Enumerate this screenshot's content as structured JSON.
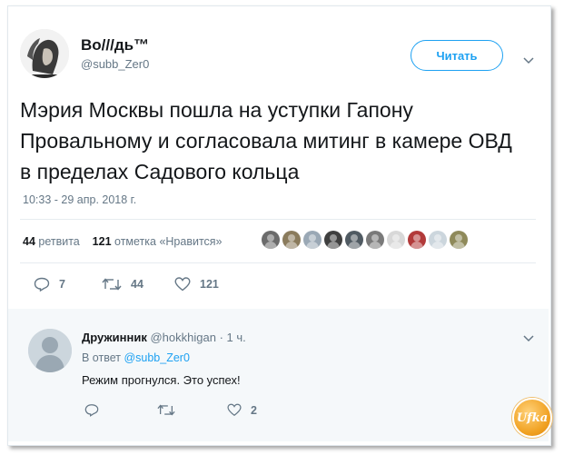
{
  "tweet": {
    "author_name": "Во///дь™",
    "author_handle": "@subb_Zer0",
    "follow_label": "Читать",
    "text": "Мэрия Москвы пошла на уступки Гапону Провальному и согласовала митинг в камере ОВД в пределах Садового кольца",
    "timestamp": "10:33 - 29 апр. 2018 г.",
    "retweets_count": "44",
    "retweets_label": "ретвита",
    "likes_count": "121",
    "likes_label": "отметка «Нравится»",
    "actions": {
      "reply_count": "7",
      "retweet_count": "44",
      "like_count": "121"
    },
    "likers": [
      {
        "icon": "liker-avatar",
        "color": "#6b6b6b"
      },
      {
        "icon": "liker-avatar",
        "color": "#8a7b5c"
      },
      {
        "icon": "liker-avatar",
        "color": "#9aa8b5"
      },
      {
        "icon": "liker-avatar",
        "color": "#3f3f3f"
      },
      {
        "icon": "liker-avatar",
        "color": "#505a62"
      },
      {
        "icon": "liker-avatar",
        "color": "#7a7a7a"
      },
      {
        "icon": "liker-avatar",
        "color": "#d8d8d8"
      },
      {
        "icon": "liker-avatar",
        "color": "#b23a3a"
      },
      {
        "icon": "liker-avatar",
        "color": "#ccd6dd"
      },
      {
        "icon": "liker-avatar",
        "color": "#8f8a5a"
      }
    ]
  },
  "reply": {
    "author_name": "Дружинник",
    "author_handle": "@hokkhigan",
    "time": "· 1 ч.",
    "reply_to_prefix": "В ответ",
    "reply_to_handle": "@subb_Zer0",
    "text": "Режим прогнулся. Это успех!",
    "like_count": "2"
  },
  "watermark": {
    "text": "Ufka"
  },
  "colors": {
    "accent": "#1da1f2",
    "muted": "#657786",
    "text": "#14171a",
    "reply_bg": "#f5f8fa"
  }
}
